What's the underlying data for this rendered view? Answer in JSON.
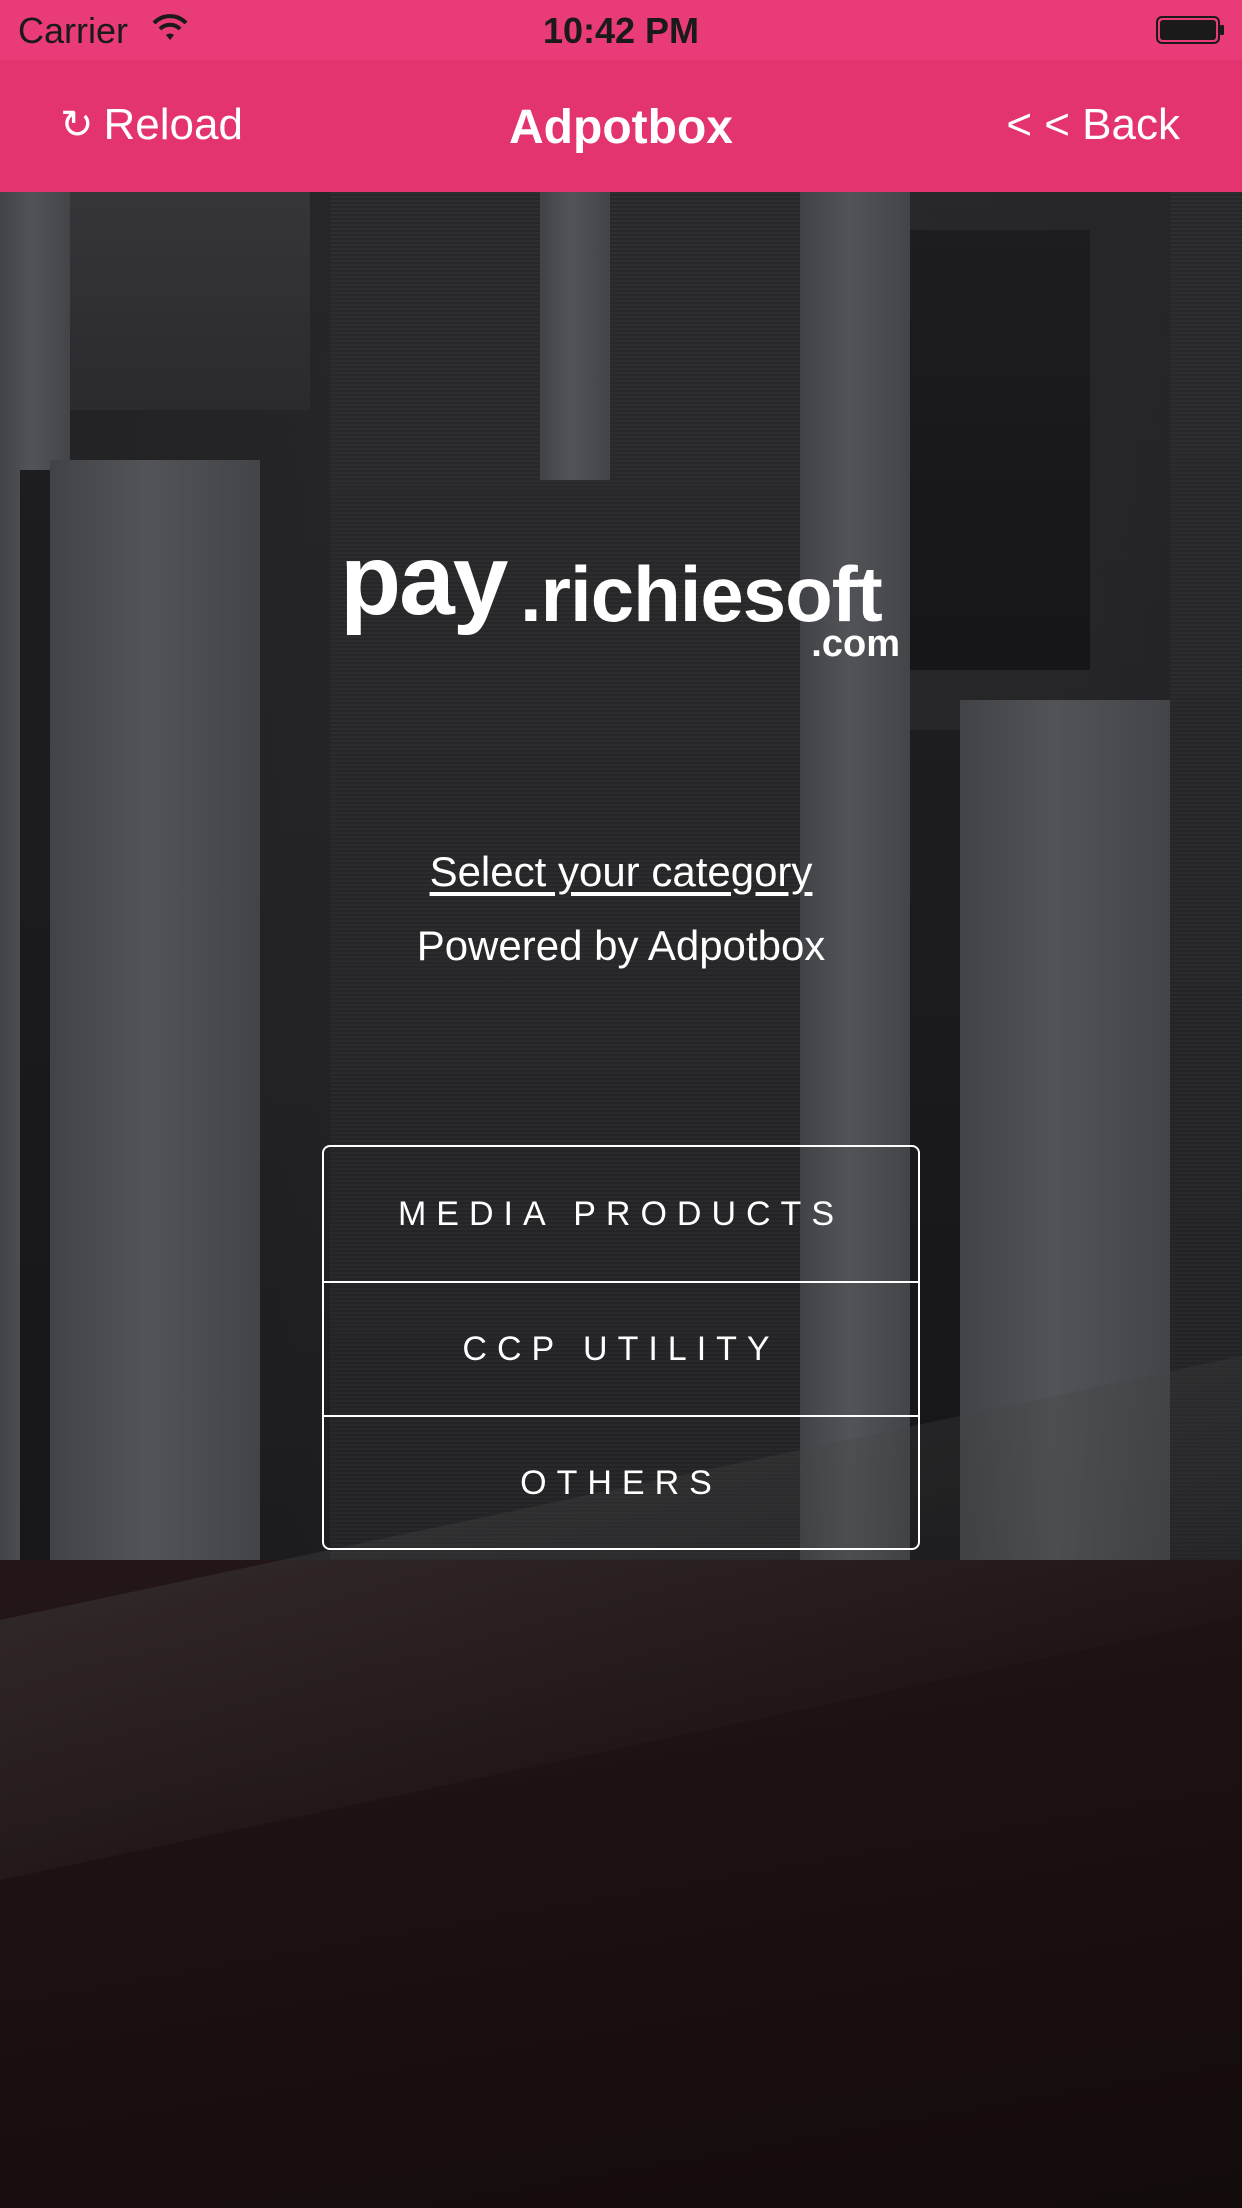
{
  "status_bar": {
    "carrier": "Carrier",
    "time": "10:42 PM"
  },
  "nav_bar": {
    "reload_label": "Reload",
    "title": "Adpotbox",
    "back_label": "< < Back"
  },
  "logo": {
    "pay": "pay",
    "domain": ".richiesoft",
    "tld": ".com"
  },
  "content": {
    "select_link": "Select your category",
    "powered_by": "Powered by Adpotbox"
  },
  "categories": [
    {
      "label": "MEDIA PRODUCTS"
    },
    {
      "label": "CCP UTILITY"
    },
    {
      "label": "OTHERS"
    }
  ],
  "colors": {
    "accent": "#e3346f",
    "status_bar": "#e83b78"
  },
  "icons": {
    "reload": "reload-icon",
    "wifi": "wifi-icon",
    "battery": "battery-icon"
  }
}
